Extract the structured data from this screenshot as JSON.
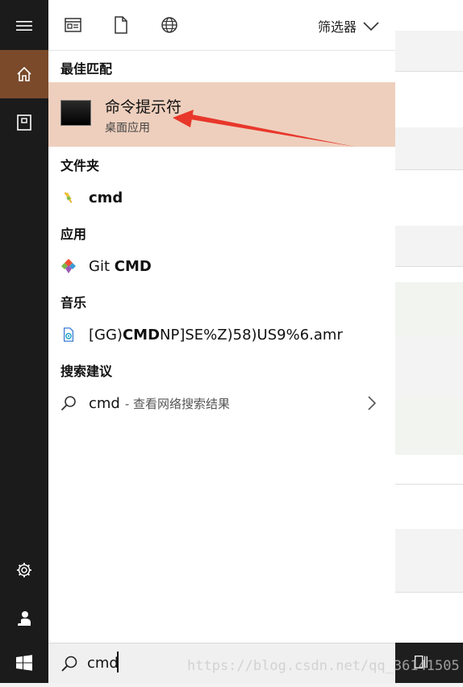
{
  "topbar": {
    "filter_label": "筛选器"
  },
  "sections": {
    "best_match": "最佳匹配",
    "folders": "文件夹",
    "apps": "应用",
    "music": "音乐",
    "suggestions": "搜索建议"
  },
  "best_match": {
    "title": "命令提示符",
    "subtitle": "桌面应用"
  },
  "results": {
    "folder": {
      "name": "cmd"
    },
    "app": {
      "prefix": "Git ",
      "bold": "CMD"
    },
    "music": {
      "prefix": "[GG)",
      "bold": "CMD",
      "suffix": "NP]SE%Z)58)US9%6.amr"
    },
    "suggestion": {
      "query": "cmd",
      "hint": "- 查看网络搜索结果"
    }
  },
  "search": {
    "value": "cmd"
  },
  "watermark": "https://blog.csdn.net/qq_36141505",
  "colors": {
    "sidebar": "#1b1b1b",
    "active_home": "#7a4a2b",
    "best_match_bg": "#eecfbd",
    "arrow": "#e8372b"
  },
  "icons": [
    "hamburger-icon",
    "home-icon",
    "document-icon",
    "settings-icon",
    "user-icon",
    "windows-logo-icon",
    "timeline-icon",
    "file-icon",
    "globe-icon",
    "chevron-down-icon",
    "search-icon",
    "chevron-right-icon",
    "folder-icon",
    "git-icon",
    "music-file-icon"
  ]
}
